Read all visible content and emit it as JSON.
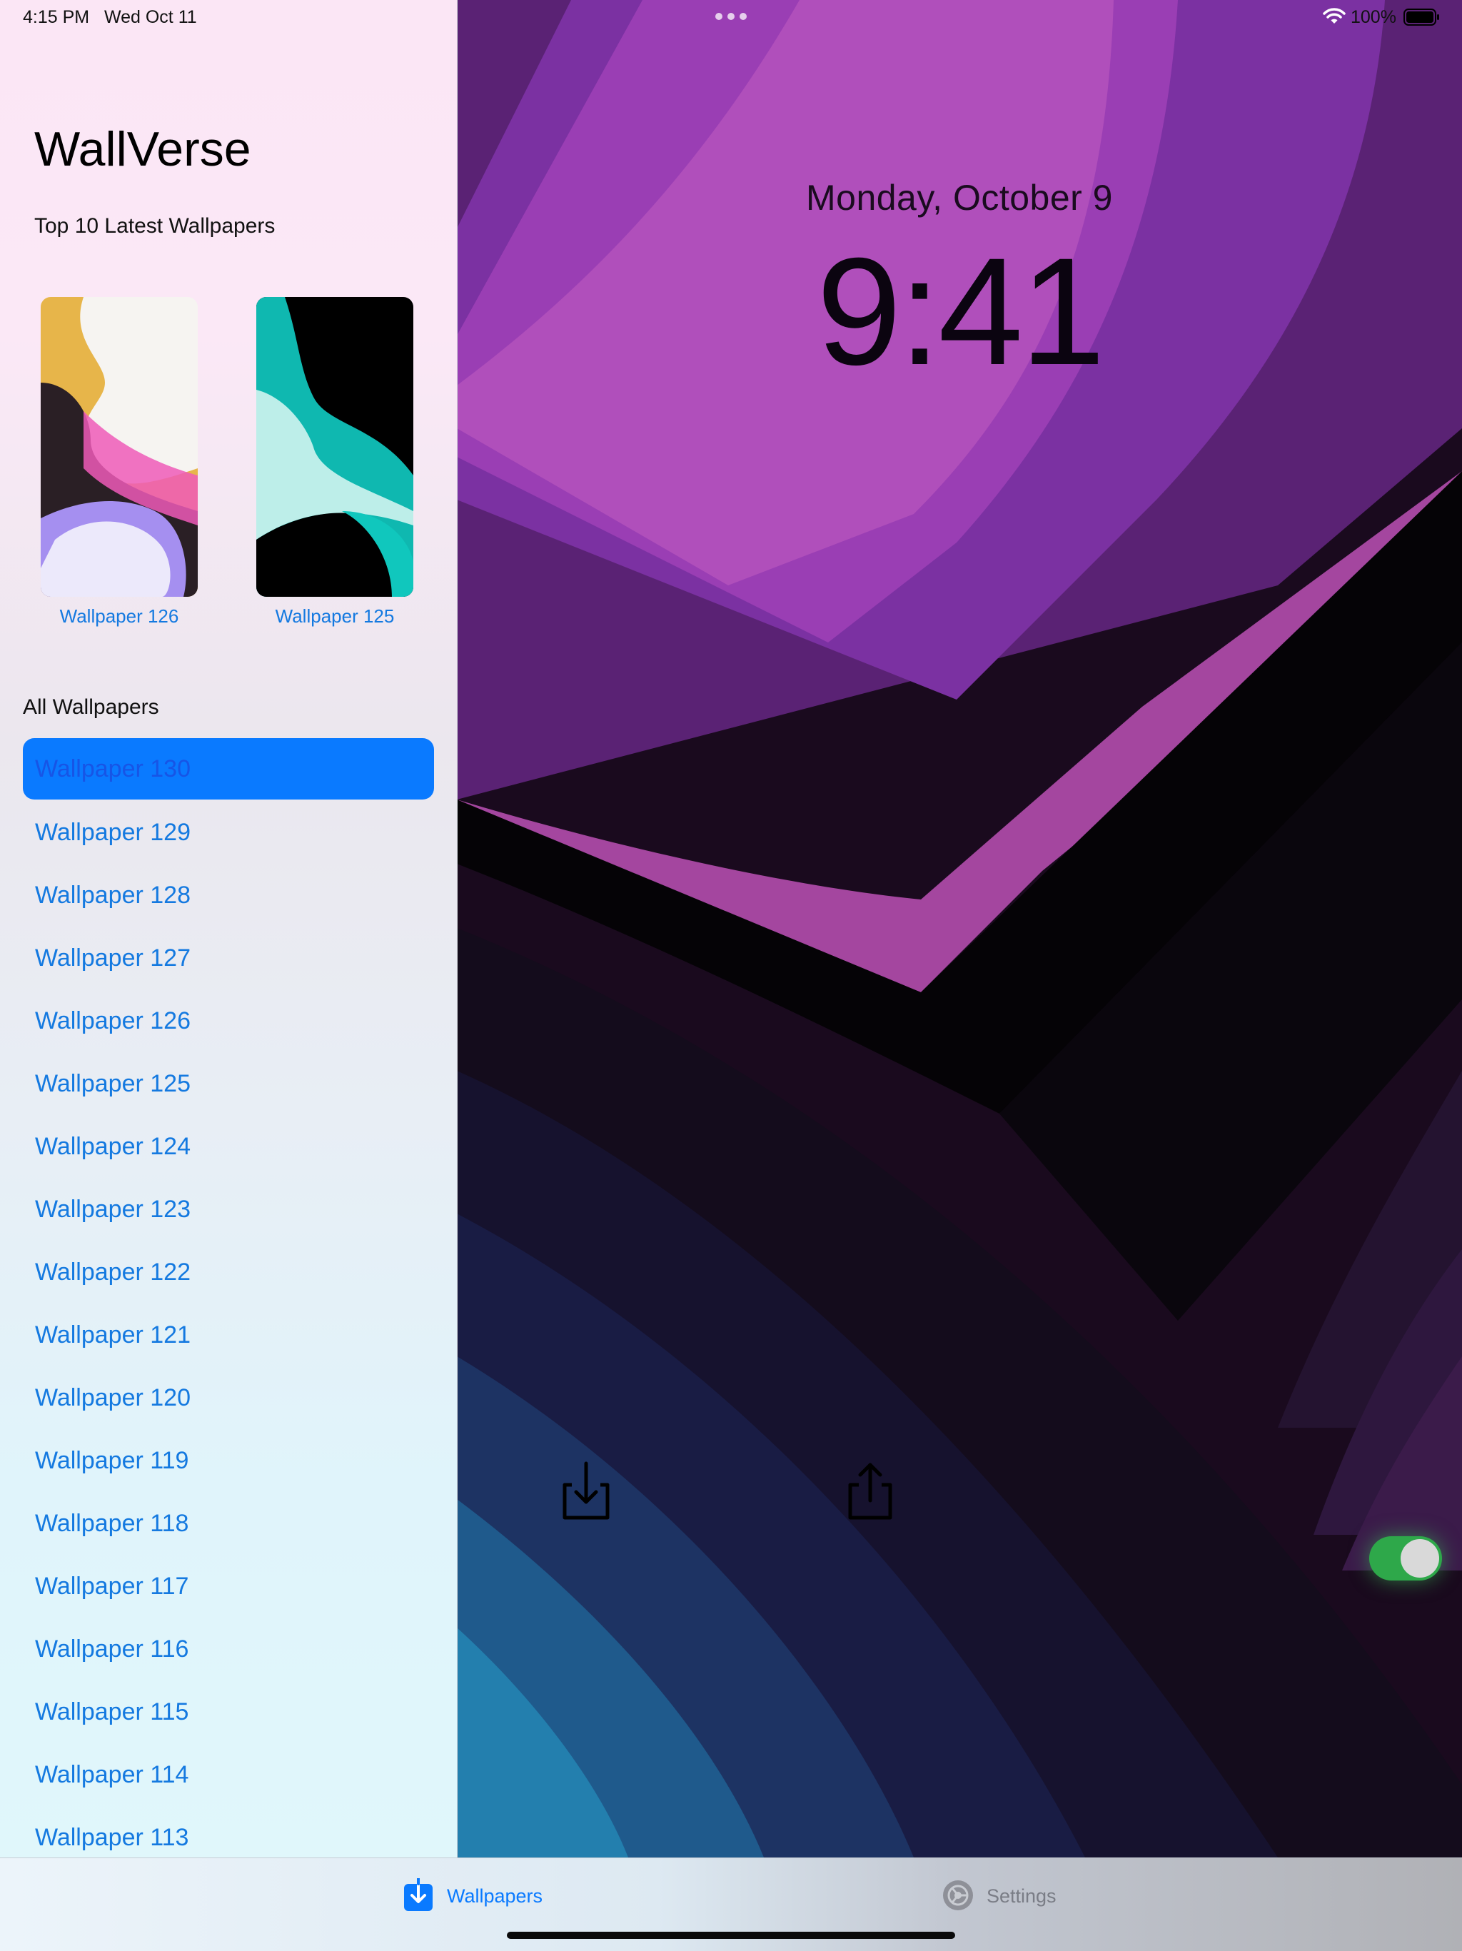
{
  "status_bar": {
    "time": "4:15 PM",
    "date": "Wed Oct 11",
    "battery_percent": "100%",
    "wifi_icon": "wifi-icon",
    "battery_icon": "battery-full-icon",
    "multitask_icon": "multitask-dots-icon"
  },
  "sidebar": {
    "app_title": "WallVerse",
    "latest_heading": "Top 10 Latest Wallpapers",
    "latest": [
      {
        "label": "Wallpaper 126"
      },
      {
        "label": "Wallpaper 125"
      }
    ],
    "all_heading": "All Wallpapers",
    "selected_index": 0,
    "items": [
      "Wallpaper 130",
      "Wallpaper 129",
      "Wallpaper 128",
      "Wallpaper 127",
      "Wallpaper 126",
      "Wallpaper 125",
      "Wallpaper 124",
      "Wallpaper 123",
      "Wallpaper 122",
      "Wallpaper 121",
      "Wallpaper 120",
      "Wallpaper 119",
      "Wallpaper 118",
      "Wallpaper 117",
      "Wallpaper 116",
      "Wallpaper 115",
      "Wallpaper 114",
      "Wallpaper 113"
    ]
  },
  "preview": {
    "lock_date": "Monday, October 9",
    "lock_time": "9:41",
    "download_icon": "download-icon",
    "share_icon": "share-icon",
    "toggle_on": true
  },
  "tab_bar": {
    "tabs": [
      {
        "label": "Wallpapers",
        "icon": "download-tab-icon",
        "selected": true
      },
      {
        "label": "Settings",
        "icon": "settings-gear-icon",
        "selected": false
      }
    ]
  },
  "colors": {
    "accent": "#0a7aff",
    "link_text": "#1479e0",
    "toggle_on": "#2ea84a"
  }
}
